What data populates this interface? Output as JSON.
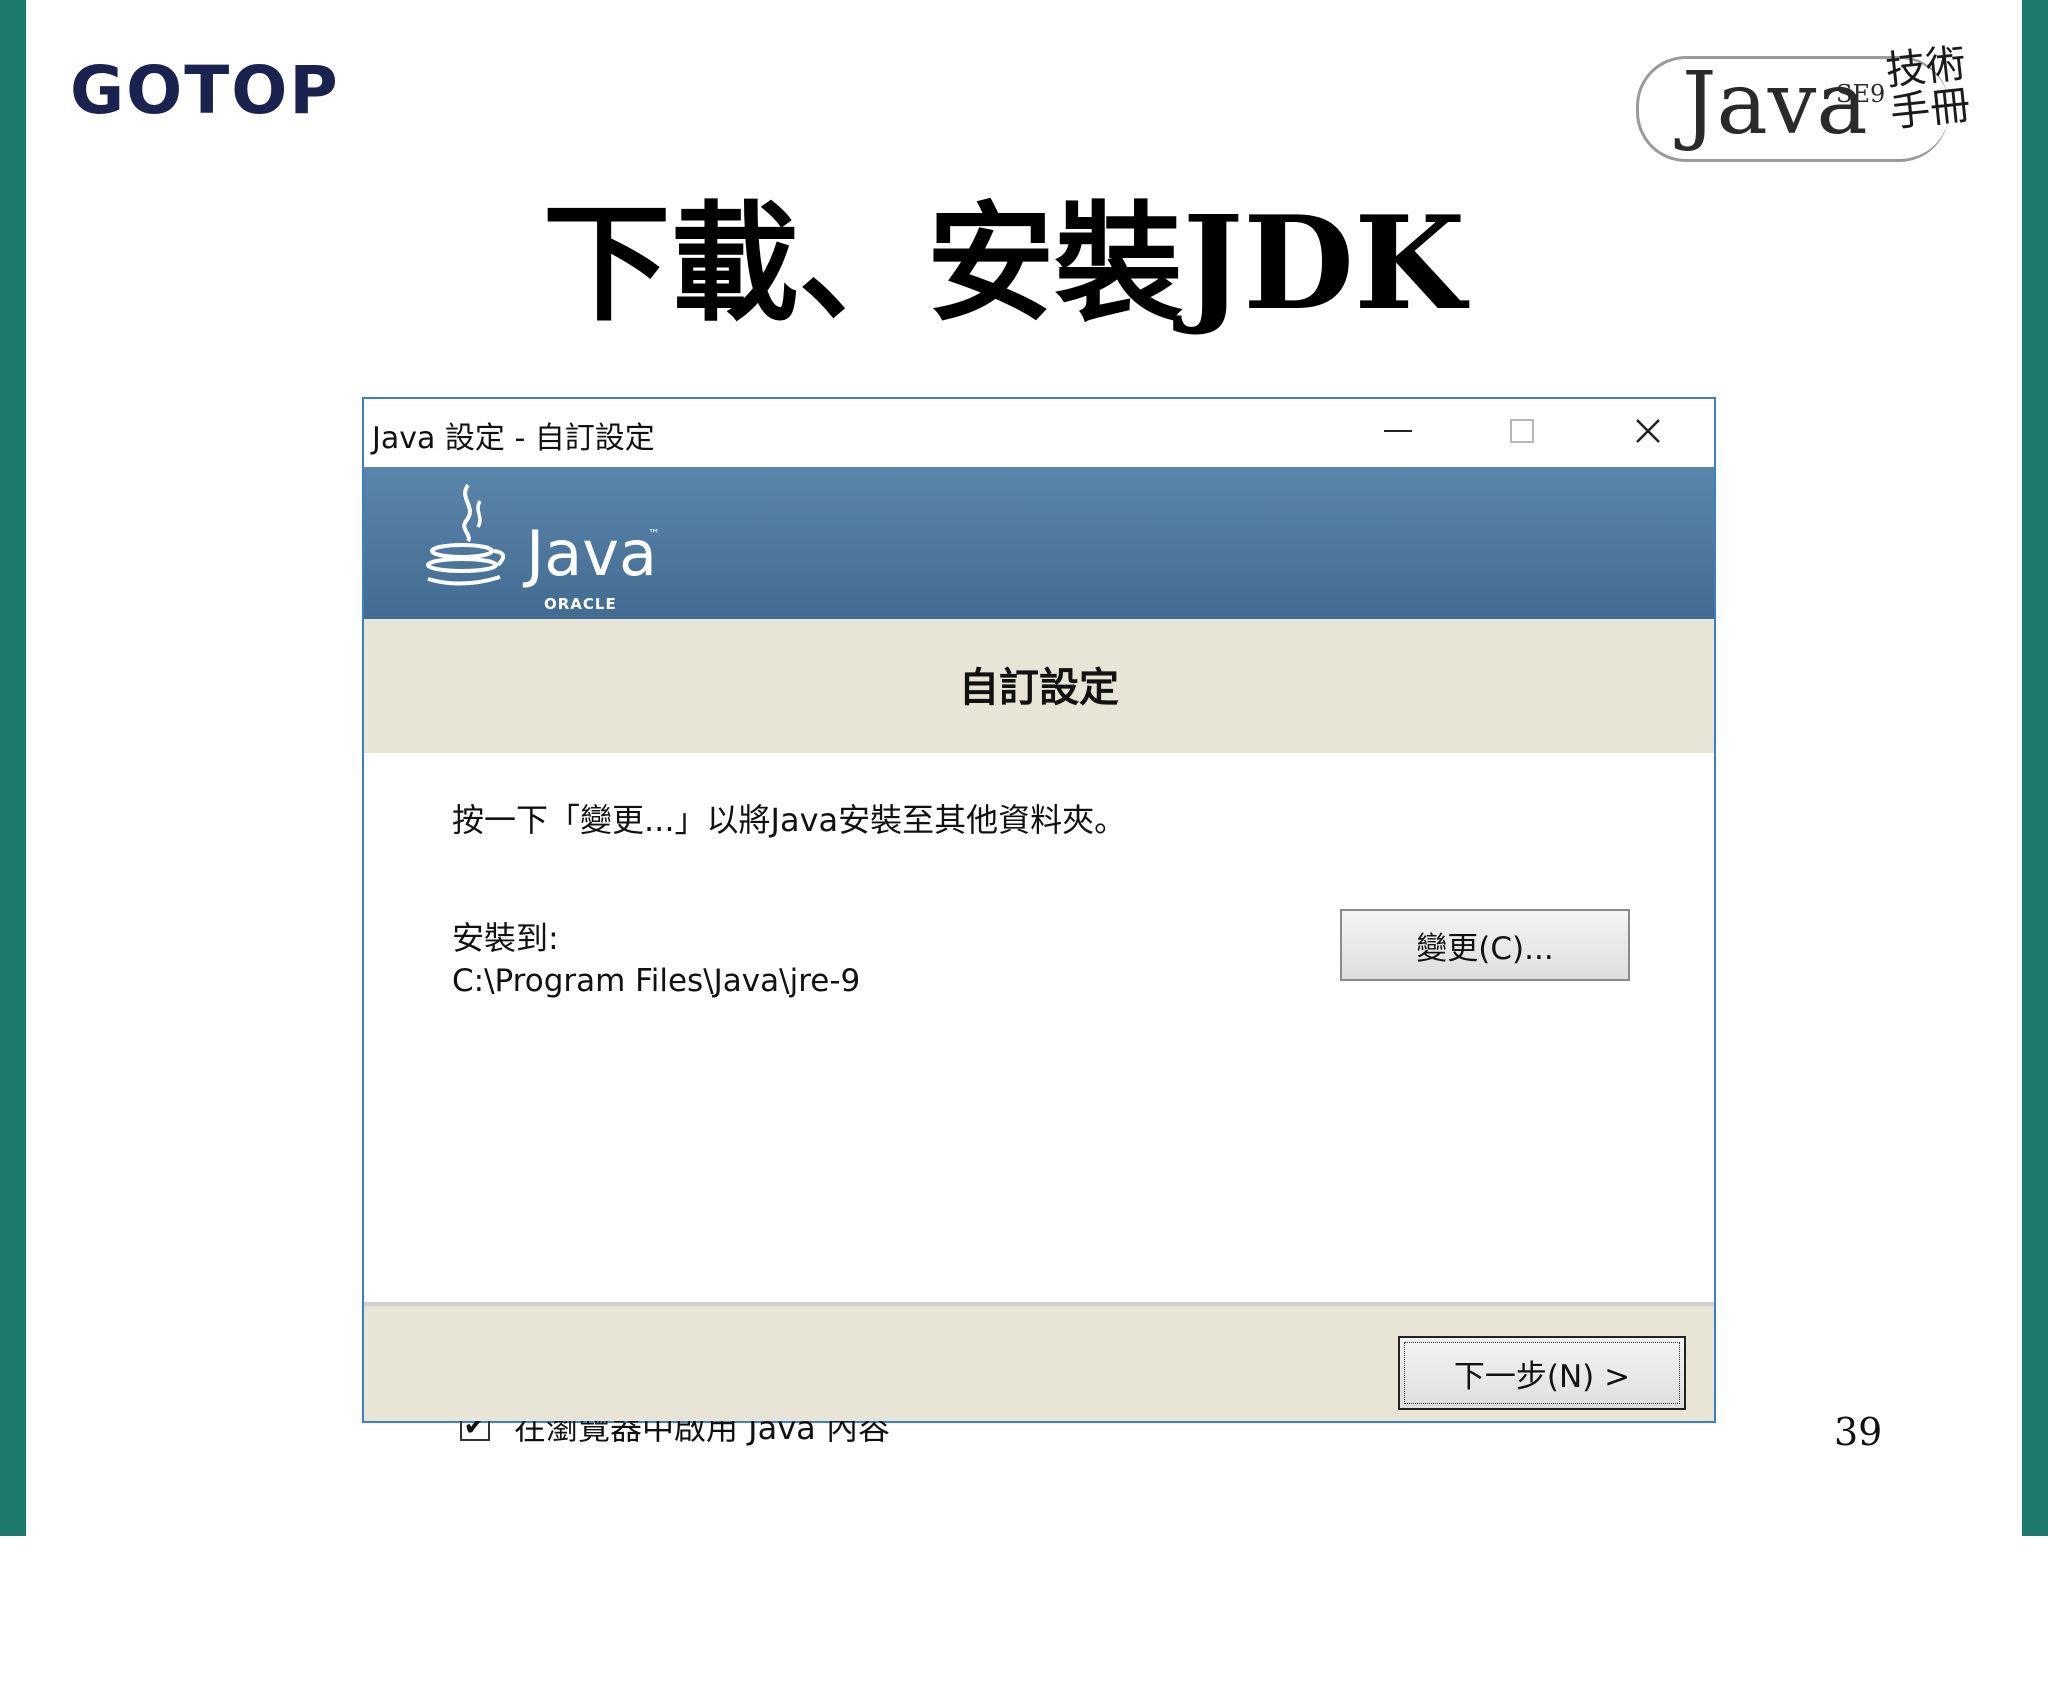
{
  "slide": {
    "publisher_logo": "GOTOP",
    "book_logo": {
      "java": "Java",
      "edition": "SE9",
      "subtitle": "技術手冊"
    },
    "title": "下載、安裝JDK",
    "page_number": "39"
  },
  "window": {
    "title": "Java 設定 - 自訂設定",
    "controls": {
      "minimize_icon": "minimize-icon",
      "maximize_icon": "maximize-icon",
      "close_icon": "close-icon",
      "close_glyph": "✕"
    },
    "banner": {
      "logo_text": "Java",
      "trademark": "™",
      "vendor": "ORACLE"
    },
    "section_heading": "自訂設定",
    "instruction": "按一下「變更...」以將Java安裝至其他資料夾。",
    "install_to_label": "安裝到:",
    "install_path": "C:\\Program Files\\Java\\jre-9",
    "change_button": "變更(C)...",
    "browser_checkbox": {
      "checked": true,
      "check_glyph": "✔",
      "label": "在瀏覽器中啟用 Java 內容"
    },
    "next_button": "下一步(N) >"
  },
  "colors": {
    "side_bar": "#1e7a6b",
    "window_border": "#3b7fc4",
    "banner_top": "#5b86ab",
    "banner_bottom": "#426b92",
    "panel": "#e8e5d6",
    "gotop": "#1a2350"
  }
}
